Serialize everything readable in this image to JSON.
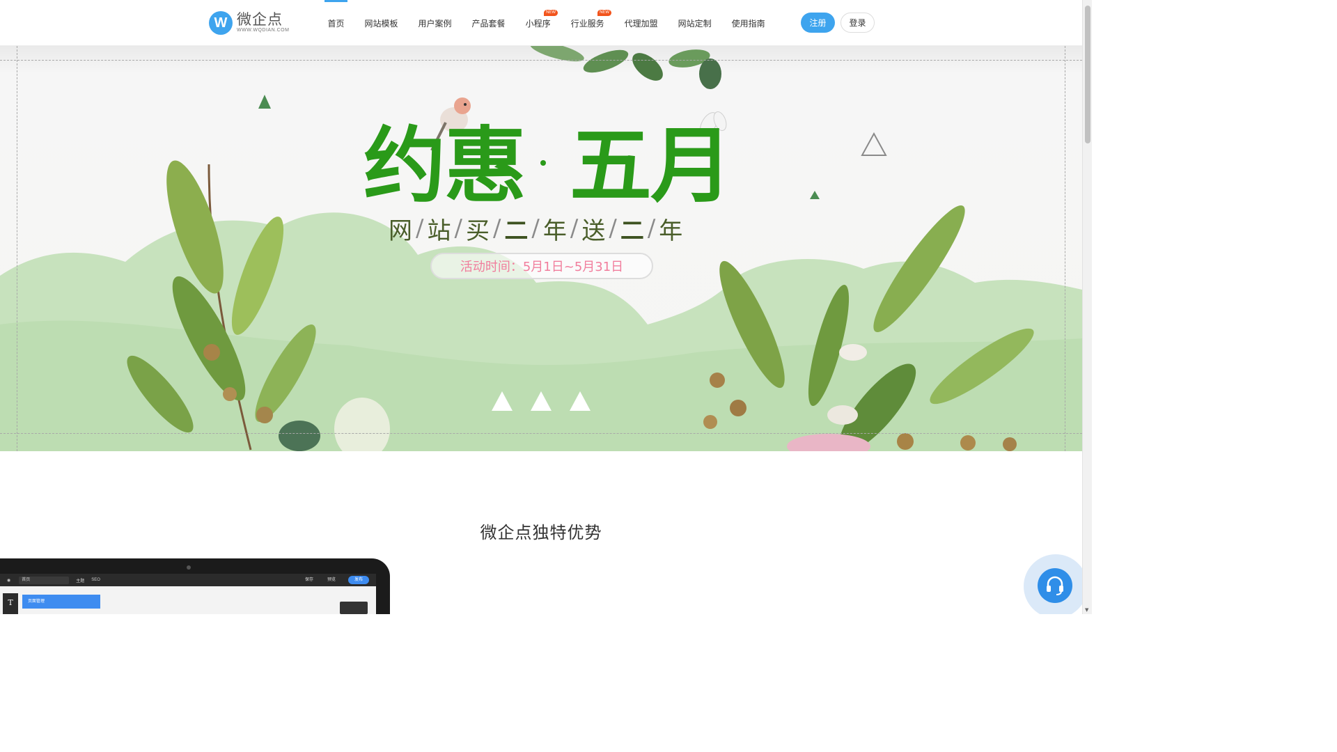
{
  "logo": {
    "mark": "W",
    "name": "微企点",
    "url": "WWW.WQDIAN.COM"
  },
  "nav": {
    "items": [
      {
        "label": "首页"
      },
      {
        "label": "网站模板"
      },
      {
        "label": "用户案例"
      },
      {
        "label": "产品套餐"
      },
      {
        "label": "小程序",
        "badge": "NEW"
      },
      {
        "label": "行业服务",
        "badge": "NEW"
      },
      {
        "label": "代理加盟"
      },
      {
        "label": "网站定制"
      },
      {
        "label": "使用指南"
      }
    ],
    "register": "注册",
    "login": "登录"
  },
  "banner": {
    "headline_left": "约惠",
    "headline_right": "五月",
    "sub_chars": [
      "网",
      "站",
      "买",
      "二",
      "年",
      "送",
      "二",
      "年"
    ],
    "separator": "/",
    "promo_period": "活动时间：5月1日~5月31日",
    "slide_count": 3,
    "colors": {
      "headline": "#2a9a19",
      "promo": "#f17e9d",
      "hills": "#c7e2bd"
    }
  },
  "section": {
    "title": "微企点独特优势"
  },
  "editor_preview": {
    "toolbar": [
      "首页",
      "主题",
      "SEO",
      "保存",
      "预览",
      "发布"
    ],
    "page_manage": "页面管理",
    "text_tool": "T"
  },
  "support": {
    "icon": "headset-icon"
  },
  "colors": {
    "accent": "#3ea4ee"
  }
}
